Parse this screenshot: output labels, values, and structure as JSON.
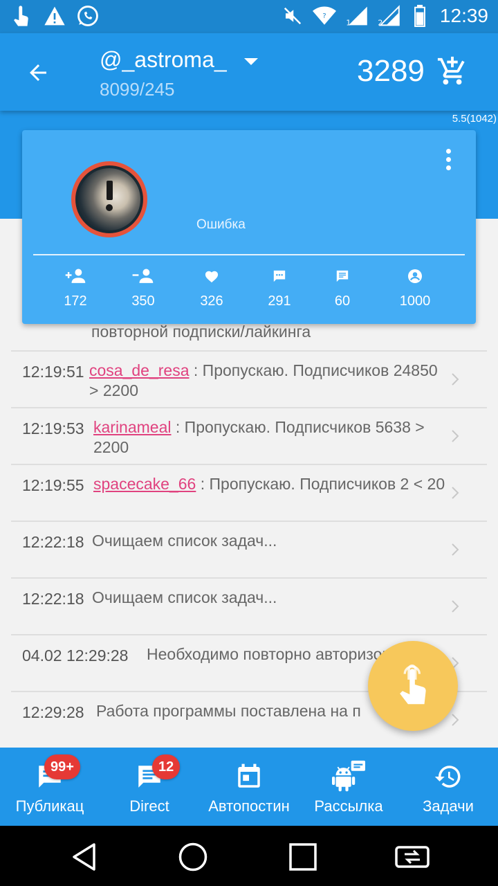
{
  "status_bar": {
    "time": "12:39",
    "sim1": "1",
    "sim2": "2",
    "icons": [
      "touch-icon",
      "warning-icon",
      "whatsapp-icon",
      "mute-icon",
      "wifi-icon",
      "signal-icon",
      "signal-icon",
      "battery-icon"
    ]
  },
  "app_bar": {
    "account": "@_astroma_",
    "stats": "8099/245",
    "balance": "3289",
    "version": "5.5(1042)"
  },
  "profile_card": {
    "error": "Ошибка",
    "stats": [
      {
        "icon": "follow-icon",
        "value": "172"
      },
      {
        "icon": "unfollow-icon",
        "value": "350"
      },
      {
        "icon": "like-icon",
        "value": "326"
      },
      {
        "icon": "comment-icon",
        "value": "291"
      },
      {
        "icon": "message-icon",
        "value": "60"
      },
      {
        "icon": "account-icon",
        "value": "1000"
      }
    ]
  },
  "log": {
    "partial_text": "повторной подписки/лайкинга",
    "rows": [
      {
        "time": "12:19:51",
        "user": "cosa_de_resa",
        "text": " : Пропускаю. Подписчиков 24850 > 2200"
      },
      {
        "time": "12:19:53",
        "user": "karinameal",
        "text": " : Пропускаю. Подписчиков 5638 > 2200"
      },
      {
        "time": "12:19:55",
        "user": "spacecake_66",
        "text": " : Пропускаю. Подписчиков 2 < 20"
      },
      {
        "time": "12:22:18",
        "user": "",
        "text": "Очищаем список задач..."
      },
      {
        "time": "12:22:18",
        "user": "",
        "text": "Очищаем список задач..."
      },
      {
        "time": "04.02 12:29:28",
        "user": "",
        "text": "Необходимо повторно авторизоваться"
      },
      {
        "time": "12:29:28",
        "user": "",
        "text": "Работа программы поставлена на п"
      }
    ]
  },
  "bottom_nav": [
    {
      "label": "Публикац",
      "badge": "99+",
      "icon": "chat-icon"
    },
    {
      "label": "Direct",
      "badge": "12",
      "icon": "direct-message-icon"
    },
    {
      "label": "Автопостин",
      "badge": "",
      "icon": "calendar-icon"
    },
    {
      "label": "Рассылка",
      "badge": "",
      "icon": "android-broadcast-icon"
    },
    {
      "label": "Задачи",
      "badge": "",
      "icon": "history-icon"
    }
  ],
  "colors": {
    "status_bar": "#1c86cf",
    "primary": "#2196e8",
    "card": "#44adf5",
    "link": "#e0427f",
    "badge": "#e53935",
    "fab": "#f7c85b"
  }
}
